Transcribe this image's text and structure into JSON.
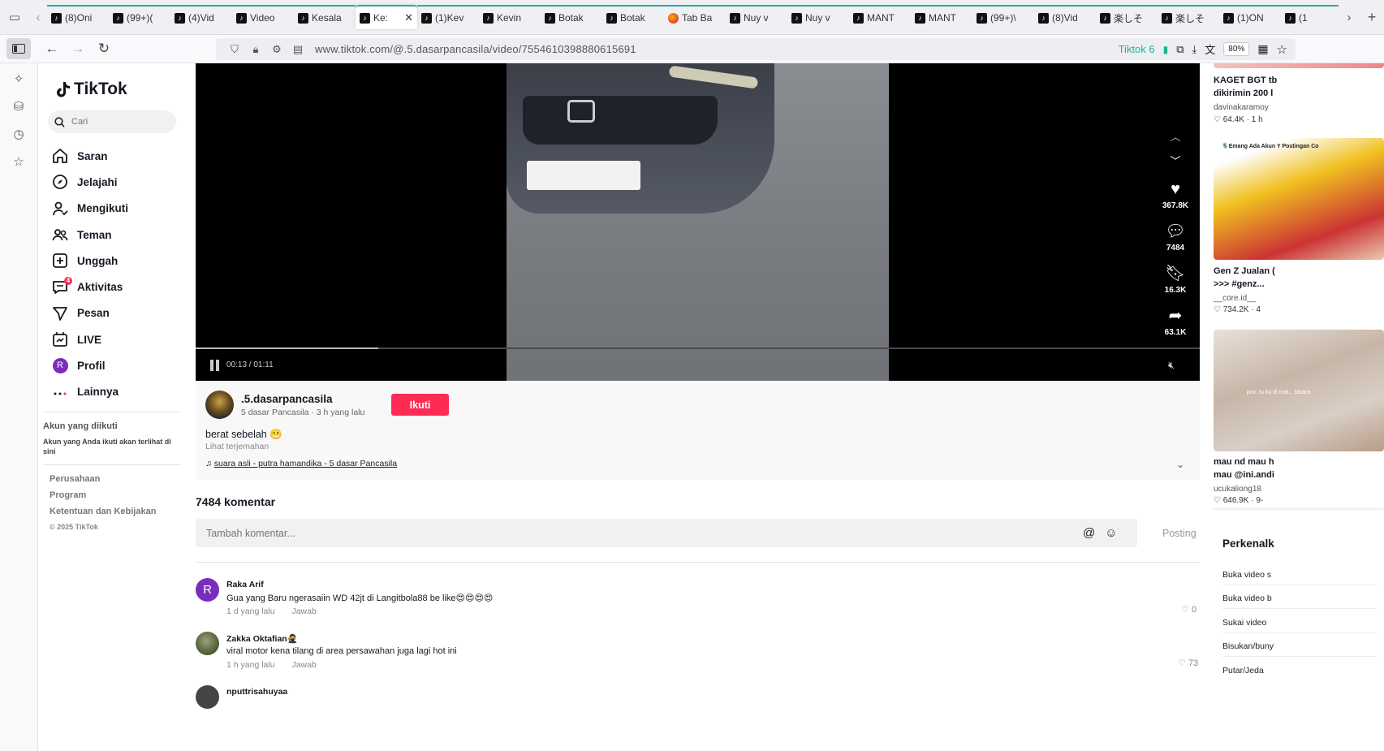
{
  "browser": {
    "tabs": [
      {
        "label": "(8)Oni",
        "icon": "tiktok-icon"
      },
      {
        "label": "(99+)(",
        "icon": "tiktok-icon"
      },
      {
        "label": "(4)Vid",
        "icon": "tiktok-icon"
      },
      {
        "label": "Video",
        "icon": "tiktok-icon"
      },
      {
        "label": "Kesala",
        "icon": "tiktok-icon"
      },
      {
        "label": "Ke:",
        "icon": "tiktok-icon",
        "active": true
      },
      {
        "label": "(1)Kev",
        "icon": "tiktok-icon"
      },
      {
        "label": "Kevin",
        "icon": "tiktok-icon"
      },
      {
        "label": "Botak",
        "icon": "tiktok-icon"
      },
      {
        "label": "Botak",
        "icon": "tiktok-icon"
      },
      {
        "label": "Tab Ba",
        "icon": "firefox-icon"
      },
      {
        "label": "Nuy v",
        "icon": "tiktok-icon"
      },
      {
        "label": "Nuy v",
        "icon": "tiktok-icon"
      },
      {
        "label": "MANT",
        "icon": "tiktok-icon"
      },
      {
        "label": "MANT",
        "icon": "tiktok-icon"
      },
      {
        "label": "(99+)\\",
        "icon": "tiktok-icon"
      },
      {
        "label": "(8)Vid",
        "icon": "tiktok-icon"
      },
      {
        "label": "楽しそ",
        "icon": "tiktok-icon"
      },
      {
        "label": "楽しそ",
        "icon": "tiktok-icon"
      },
      {
        "label": "(1)ON",
        "icon": "tiktok-icon"
      },
      {
        "label": "(1",
        "icon": "tiktok-icon"
      }
    ],
    "url": "www.tiktok.com/@.5.dasarpancasila/video/7554610398880615691",
    "extension_badge": "Tiktok 6",
    "zoom": "80%"
  },
  "sidebar": {
    "logo": "TikTok",
    "search_placeholder": "Cari",
    "items": [
      {
        "label": "Saran",
        "icon": "home-icon"
      },
      {
        "label": "Jelajahi",
        "icon": "compass-icon"
      },
      {
        "label": "Mengikuti",
        "icon": "following-icon"
      },
      {
        "label": "Teman",
        "icon": "friends-icon"
      },
      {
        "label": "Unggah",
        "icon": "upload-icon"
      },
      {
        "label": "Aktivitas",
        "icon": "activity-icon",
        "badge": "4"
      },
      {
        "label": "Pesan",
        "icon": "send-icon"
      },
      {
        "label": "LIVE",
        "icon": "live-icon"
      },
      {
        "label": "Profil",
        "icon": "avatar-r",
        "avatar_letter": "R"
      },
      {
        "label": "Lainnya",
        "icon": "more-icon"
      }
    ],
    "following_title": "Akun yang diikuti",
    "following_desc": "Akun yang Anda ikuti akan terlihat di sini",
    "footer": [
      "Perusahaan",
      "Program",
      "Ketentuan dan Kebijakan"
    ],
    "copyright": "© 2025 TikTok"
  },
  "video": {
    "time": "00:13 / 01:11",
    "progress": 0.182,
    "likes": "367.8K",
    "comments": "7484",
    "saves": "16.3K",
    "shares": "63.1K"
  },
  "post": {
    "author": ".5.dasarpancasila",
    "meta": "5 dasar Pancasila · 3 h yang lalu",
    "follow_label": "Ikuti",
    "caption": "berat sebelah 😬",
    "translate": "Lihat terjemahan",
    "music": "suara asli - putra hamandika - 5 dasar Pancasila"
  },
  "comments": {
    "count_label": "7484 komentar",
    "placeholder": "Tambah komentar...",
    "post_label": "Posting",
    "items": [
      {
        "user": "Raka Arif",
        "text": "Gua yang Baru ngerasaiin WD 42jt di Langitbola88 be like😍😍😍😍",
        "time": "1 d yang lalu",
        "reply": "Jawab",
        "likes": "0",
        "avatar_letter": "R"
      },
      {
        "user": "Zakka Oktafian🥷",
        "text": "viral motor kena tilang di area persawahan juga lagi hot ini",
        "time": "1 h yang lalu",
        "reply": "Jawab",
        "likes": "73"
      },
      {
        "user": "nputtrisahuyaa",
        "text": "",
        "time": "",
        "reply": "",
        "likes": ""
      }
    ]
  },
  "recommendations": [
    {
      "title": "KAGET BGT tb",
      "title2": "dikirimin 200 l",
      "author": "davinakaramoy",
      "stats": "64.4K · 1 h"
    },
    {
      "title": "Gen Z Jualan (",
      "title2": ">>> #genz...",
      "author": "__core.id__",
      "stats": "734.2K · 4",
      "overlay": "🎙️Emang Ada Akun Y Postingan Co"
    },
    {
      "title": "mau nd mau h",
      "title2": "mau @ini.andi",
      "author": "ucukaliong18",
      "stats": "646.9K · 9-",
      "overlay": "pov: tu ku di mat... bicara"
    }
  ],
  "shortcuts": {
    "title": "Perkenalk",
    "items": [
      "Buka video s",
      "Buka video b",
      "Sukai video",
      "Bisukan/buny",
      "Putar/Jeda"
    ]
  }
}
